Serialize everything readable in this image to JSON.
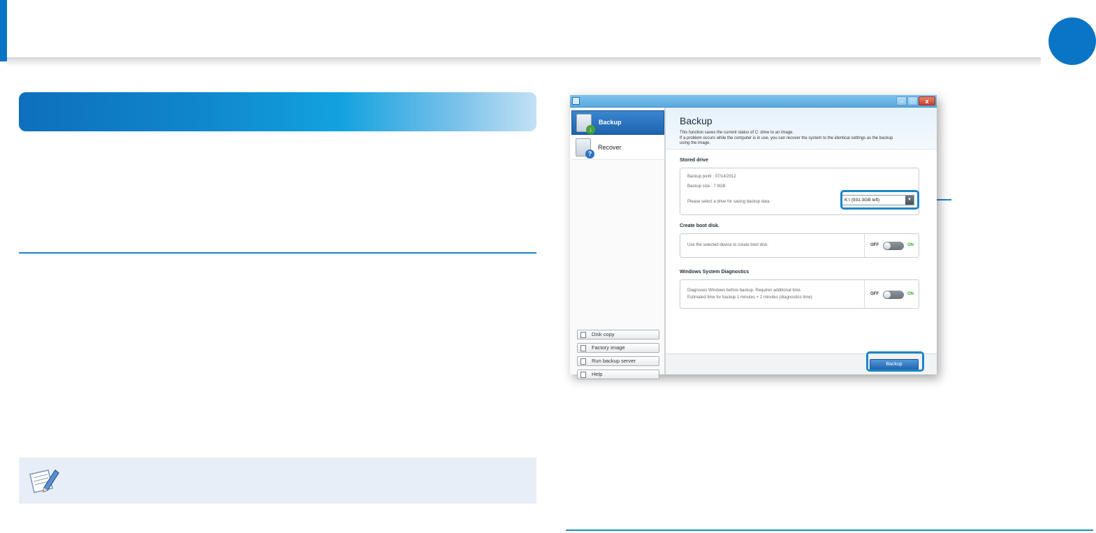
{
  "screenshot": {
    "title": "Backup",
    "description_line1": "This function saves the current status of C: drive to an image.",
    "description_line2": "If a problem occurs while the computer is in use, you can recover the system to the identical settings as the backup",
    "description_line3": "using the image.",
    "sidebar": {
      "nav_backup": "Backup",
      "nav_recover": "Recover",
      "buttons": [
        "Disk copy",
        "Factory image",
        "Run backup server",
        "Help"
      ]
    },
    "stored_drive": {
      "heading": "Stored drive",
      "backup_point": "Backup point : 07/14/2012",
      "backup_size": "Backup size : 7.9GB",
      "hint": "Please select a drive for saving backup data.",
      "drive_value": "K:\\ (931.3GB left)"
    },
    "boot_disk": {
      "heading": "Create boot disk.",
      "text": "Use the selected device to create boot disk.",
      "off_label": "OFF",
      "on_label": "ON"
    },
    "diagnostics": {
      "heading": "Windows System Diagnostics",
      "text_line1": "Diagnoses Windows before backup. Requires additional time.",
      "text_line2": "Estimated time for backup 1 minutes + 2 minutes (diagnostics time)",
      "off_label": "OFF",
      "on_label": "ON"
    },
    "backup_button": "Backup",
    "window_buttons": {
      "minimize": "–",
      "maximize": "□",
      "close": "x"
    }
  },
  "colors": {
    "accent": "#0a74c5",
    "callout": "#1a86c8",
    "note_background": "#e7eef7",
    "on_green": "#3aa53a"
  },
  "icons": {
    "note": "pencil-note-icon",
    "app": "app-window-icon"
  }
}
